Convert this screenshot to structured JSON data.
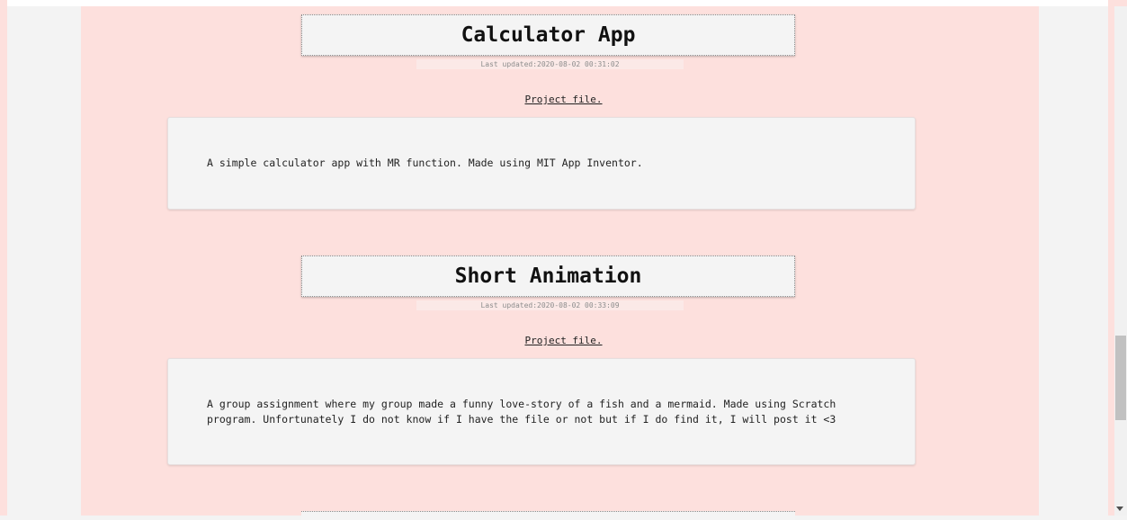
{
  "projects": [
    {
      "title": "Calculator App",
      "updated": "Last updated:2020-08-02 00:31:02",
      "link": "Project file.",
      "description": "A simple calculator app with MR function. Made using MIT App Inventor."
    },
    {
      "title": "Short Animation",
      "updated": "Last updated:2020-08-02 00:33:09",
      "link": "Project file.",
      "description": "A group assignment where my group made a funny love-story of a fish and a mermaid. Made using Scratch program. Unfortunately I do not know if I have the file or not but if I do find it, I will post it <3"
    }
  ],
  "colors": {
    "page_background": "#fde0dd",
    "card_background": "#f4f4f4",
    "outer_background": "#f3f3f3"
  }
}
